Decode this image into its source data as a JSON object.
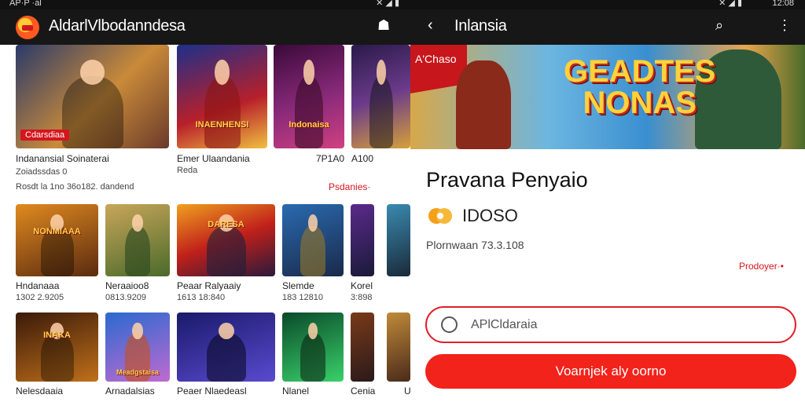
{
  "status_left": {
    "time": "AP·P ·al"
  },
  "status_right": {
    "time": "12:08"
  },
  "left_screen": {
    "title": "AldarlVlbodanndesa",
    "rows": [
      {
        "tiles": [
          {
            "badge": "Cdarsdiaa"
          },
          {
            "logo": "INAENHENSI"
          },
          {
            "logo": "Indonaisa"
          },
          {}
        ],
        "captions": [
          {
            "title": "Indanansial Soinaterai",
            "line2": "Zoiadssdas 0",
            "line3": "Rosdt la 1no 36o182. dandend"
          },
          {
            "title": "Emer Ulaandania",
            "line2": "Reda"
          },
          {
            "title": "7P1A0"
          },
          {
            "title": "A100"
          }
        ],
        "more": "Psdanies·"
      },
      {
        "tiles": [
          {
            "logo": "NONMIAAA"
          },
          {},
          {
            "logo": "DARESA"
          },
          {},
          {},
          {}
        ],
        "captions": [
          {
            "title": "Hndanaaa",
            "line2": "1302 2.9205"
          },
          {
            "title": "Neraaioo8",
            "line2": "0813.9209"
          },
          {
            "title": "Peaar Ralyaaiy",
            "line2": "1613 18:840"
          },
          {
            "title": "Slemde",
            "line2": "183 12810"
          },
          {
            "title": "Korel",
            "line2": "3:898"
          }
        ]
      },
      {
        "tiles": [
          {
            "logo": "INAKA"
          },
          {
            "logo": "Meadgstaisa"
          },
          {},
          {},
          {},
          {}
        ],
        "captions": [
          {
            "title": "Nelesdaaia"
          },
          {
            "title": "Arnadalsias"
          },
          {
            "title": "Peaer Nlaedeasl"
          },
          {
            "title": "Nlanel"
          },
          {
            "title": "Cenia"
          },
          {
            "title": "U"
          }
        ]
      }
    ]
  },
  "right_screen": {
    "title": "Inlansia",
    "banner": {
      "tag": "A'Chaso",
      "logo_line1": "GEADTES",
      "logo_line2": "NONAS"
    },
    "app_title": "Pravana Penyaio",
    "rating": "IDOSO",
    "meta": "Plornwaan 73.3.108",
    "more": "Prodoyer·•",
    "search_placeholder": "APlCldaraia",
    "cta_label": "Voarnjek aly oorno"
  }
}
